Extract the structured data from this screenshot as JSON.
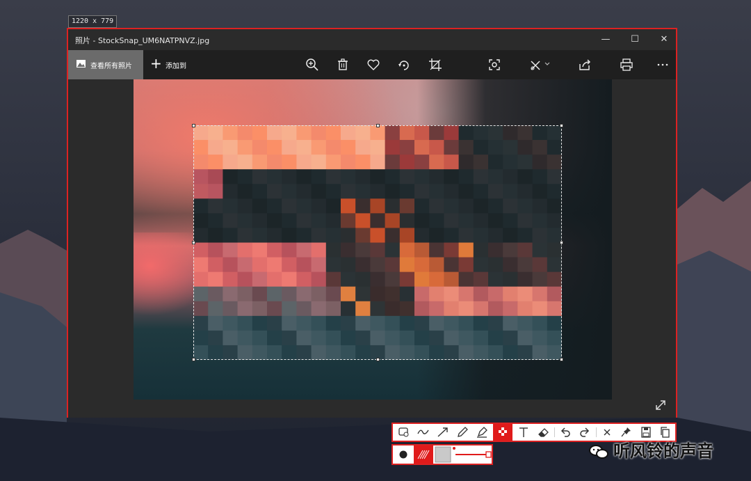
{
  "capture": {
    "size_label": "1220 x 779"
  },
  "window": {
    "title": "照片 - StockSnap_UM6NATPNVZ.jpg",
    "controls": {
      "minimize": "—",
      "maximize": "☐",
      "close": "✕"
    }
  },
  "toolbar": {
    "view_all_label": "查看所有照片",
    "add_to_label": "添加到",
    "icons": [
      "zoom-in-icon",
      "delete-icon",
      "favorite-icon",
      "rotate-icon",
      "crop-icon",
      "object-recognize-icon",
      "edit-draw-icon",
      "share-icon",
      "print-icon",
      "more-icon"
    ]
  },
  "annotation_bar": {
    "tools": [
      "shape-select",
      "freehand-line",
      "arrow",
      "pencil",
      "highlighter",
      "mosaic",
      "text",
      "eraser",
      "undo",
      "redo",
      "close",
      "pin",
      "save",
      "copy"
    ],
    "active_tool": "mosaic"
  },
  "style_bar": {
    "items": [
      "dot-size",
      "pattern",
      "color-swatch",
      "size-slider"
    ]
  },
  "watermark": {
    "text": "听风铃的声音"
  },
  "colors": {
    "accent": "#dd2222",
    "toolbar_bg": "#1f1f1f",
    "window_bg": "#2b2b2b"
  }
}
